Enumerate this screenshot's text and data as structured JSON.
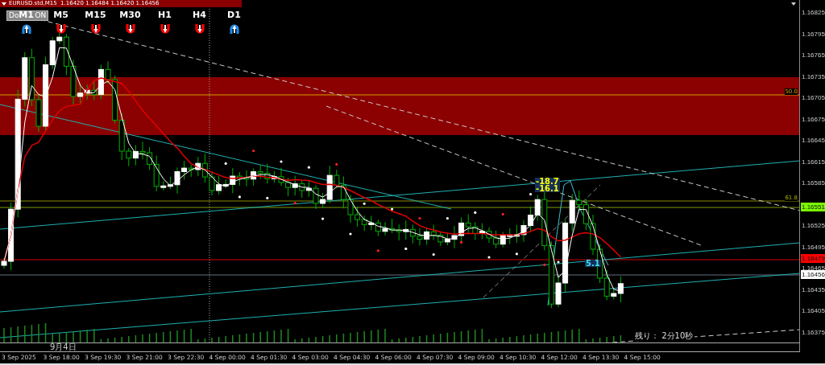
{
  "header": {
    "text": "EURUSD.std,M15  1.16420 1.16484 1.16420 1.16456"
  },
  "toggle_button": {
    "texts": [
      "Do",
      "ON"
    ]
  },
  "timeframes": [
    {
      "label": "M1",
      "up": true
    },
    {
      "label": "M5",
      "up": false
    },
    {
      "label": "M15",
      "up": false
    },
    {
      "label": "M30",
      "up": false
    },
    {
      "label": "H1",
      "up": false
    },
    {
      "label": "H4",
      "up": false
    },
    {
      "label": "D1",
      "up": true
    }
  ],
  "fib_levels": [
    {
      "text": "50.0"
    },
    {
      "text": "61.8"
    }
  ],
  "signals": [
    {
      "text": "-18.7",
      "kind": "sell"
    },
    {
      "text": "-16.1",
      "kind": "sell"
    },
    {
      "text": "5.1",
      "kind": "buy"
    }
  ],
  "countdown": "残り： 2分10秒",
  "price_axis": [
    {
      "text": "1.16825",
      "kind": "tick"
    },
    {
      "text": "1.16795",
      "kind": "tick"
    },
    {
      "text": "1.16765",
      "kind": "tick"
    },
    {
      "text": "1.16735",
      "kind": "tick"
    },
    {
      "text": "1.16705",
      "kind": "tick"
    },
    {
      "text": "1.16675",
      "kind": "tick"
    },
    {
      "text": "1.16645",
      "kind": "tick"
    },
    {
      "text": "1.16615",
      "kind": "tick"
    },
    {
      "text": "1.16585",
      "kind": "tick"
    },
    {
      "text": "1.16551",
      "kind": "marker",
      "color": "#7cfc00"
    },
    {
      "text": "1.16525",
      "kind": "tick"
    },
    {
      "text": "1.16495",
      "kind": "tick"
    },
    {
      "text": "1.16479",
      "kind": "marker",
      "color": "#ff0000"
    },
    {
      "text": "1.16465",
      "kind": "tick"
    },
    {
      "text": "1.16456",
      "kind": "marker",
      "color": "#ffffff"
    },
    {
      "text": "1.16435",
      "kind": "tick"
    },
    {
      "text": "1.16405",
      "kind": "tick"
    },
    {
      "text": "1.16375",
      "kind": "tick"
    }
  ],
  "date_marker": "9月4日",
  "time_axis": [
    "3 Sep 2025",
    "3 Sep 18:00",
    "3 Sep 19:30",
    "3 Sep 21:00",
    "3 Sep 22:30",
    "4 Sep 00:00",
    "4 Sep 01:30",
    "4 Sep 03:00",
    "4 Sep 04:30",
    "4 Sep 06:00",
    "4 Sep 07:30",
    "4 Sep 09:00",
    "4 Sep 10:30",
    "4 Sep 12:00",
    "4 Sep 13:30",
    "4 Sep 15:00"
  ]
}
